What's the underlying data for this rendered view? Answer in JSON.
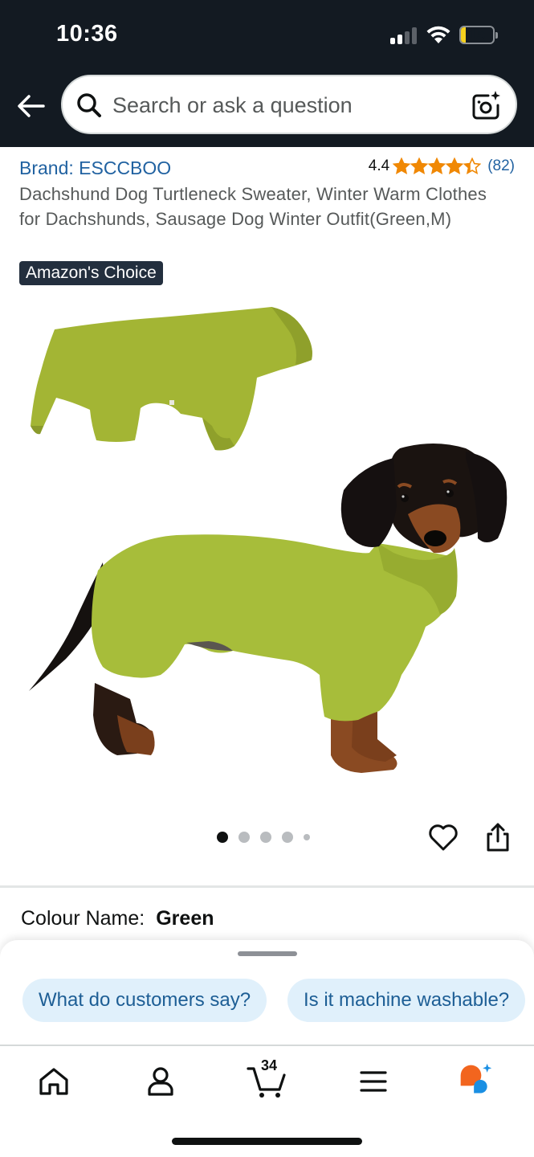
{
  "status_bar": {
    "time": "10:36",
    "battery": "15",
    "battery_level": 0.15,
    "signal_bars": 2
  },
  "search": {
    "placeholder": "Search or ask a question"
  },
  "product": {
    "brand": "Brand: ESCCBOO",
    "rating_value": "4.4",
    "rating": 4.4,
    "rating_count": "(82)",
    "title": "Dachshund Dog Turtleneck Sweater, Winter Warm Clothes for Dachshunds, Sausage Dog Winter Outfit(Green,M)",
    "badge": "Amazon's Choice",
    "image_count": 5,
    "active_image": 1,
    "colour_label": "Colour Name:",
    "colour_value": "Green"
  },
  "rufus": {
    "chips": [
      "What do customers say?",
      "Is it machine washable?"
    ]
  },
  "bottom_nav": {
    "cart_count": "34",
    "items": [
      "home-icon",
      "account-icon",
      "cart-icon",
      "menu-icon",
      "rufus-icon"
    ]
  },
  "colors": {
    "topbar": "#131a22",
    "link": "#2162a1",
    "star": "#f08804",
    "badge": "#232f3e",
    "chip_bg": "#e0f0fb",
    "chip_text": "#1d5e95",
    "sweater": "#a7bd3a"
  }
}
